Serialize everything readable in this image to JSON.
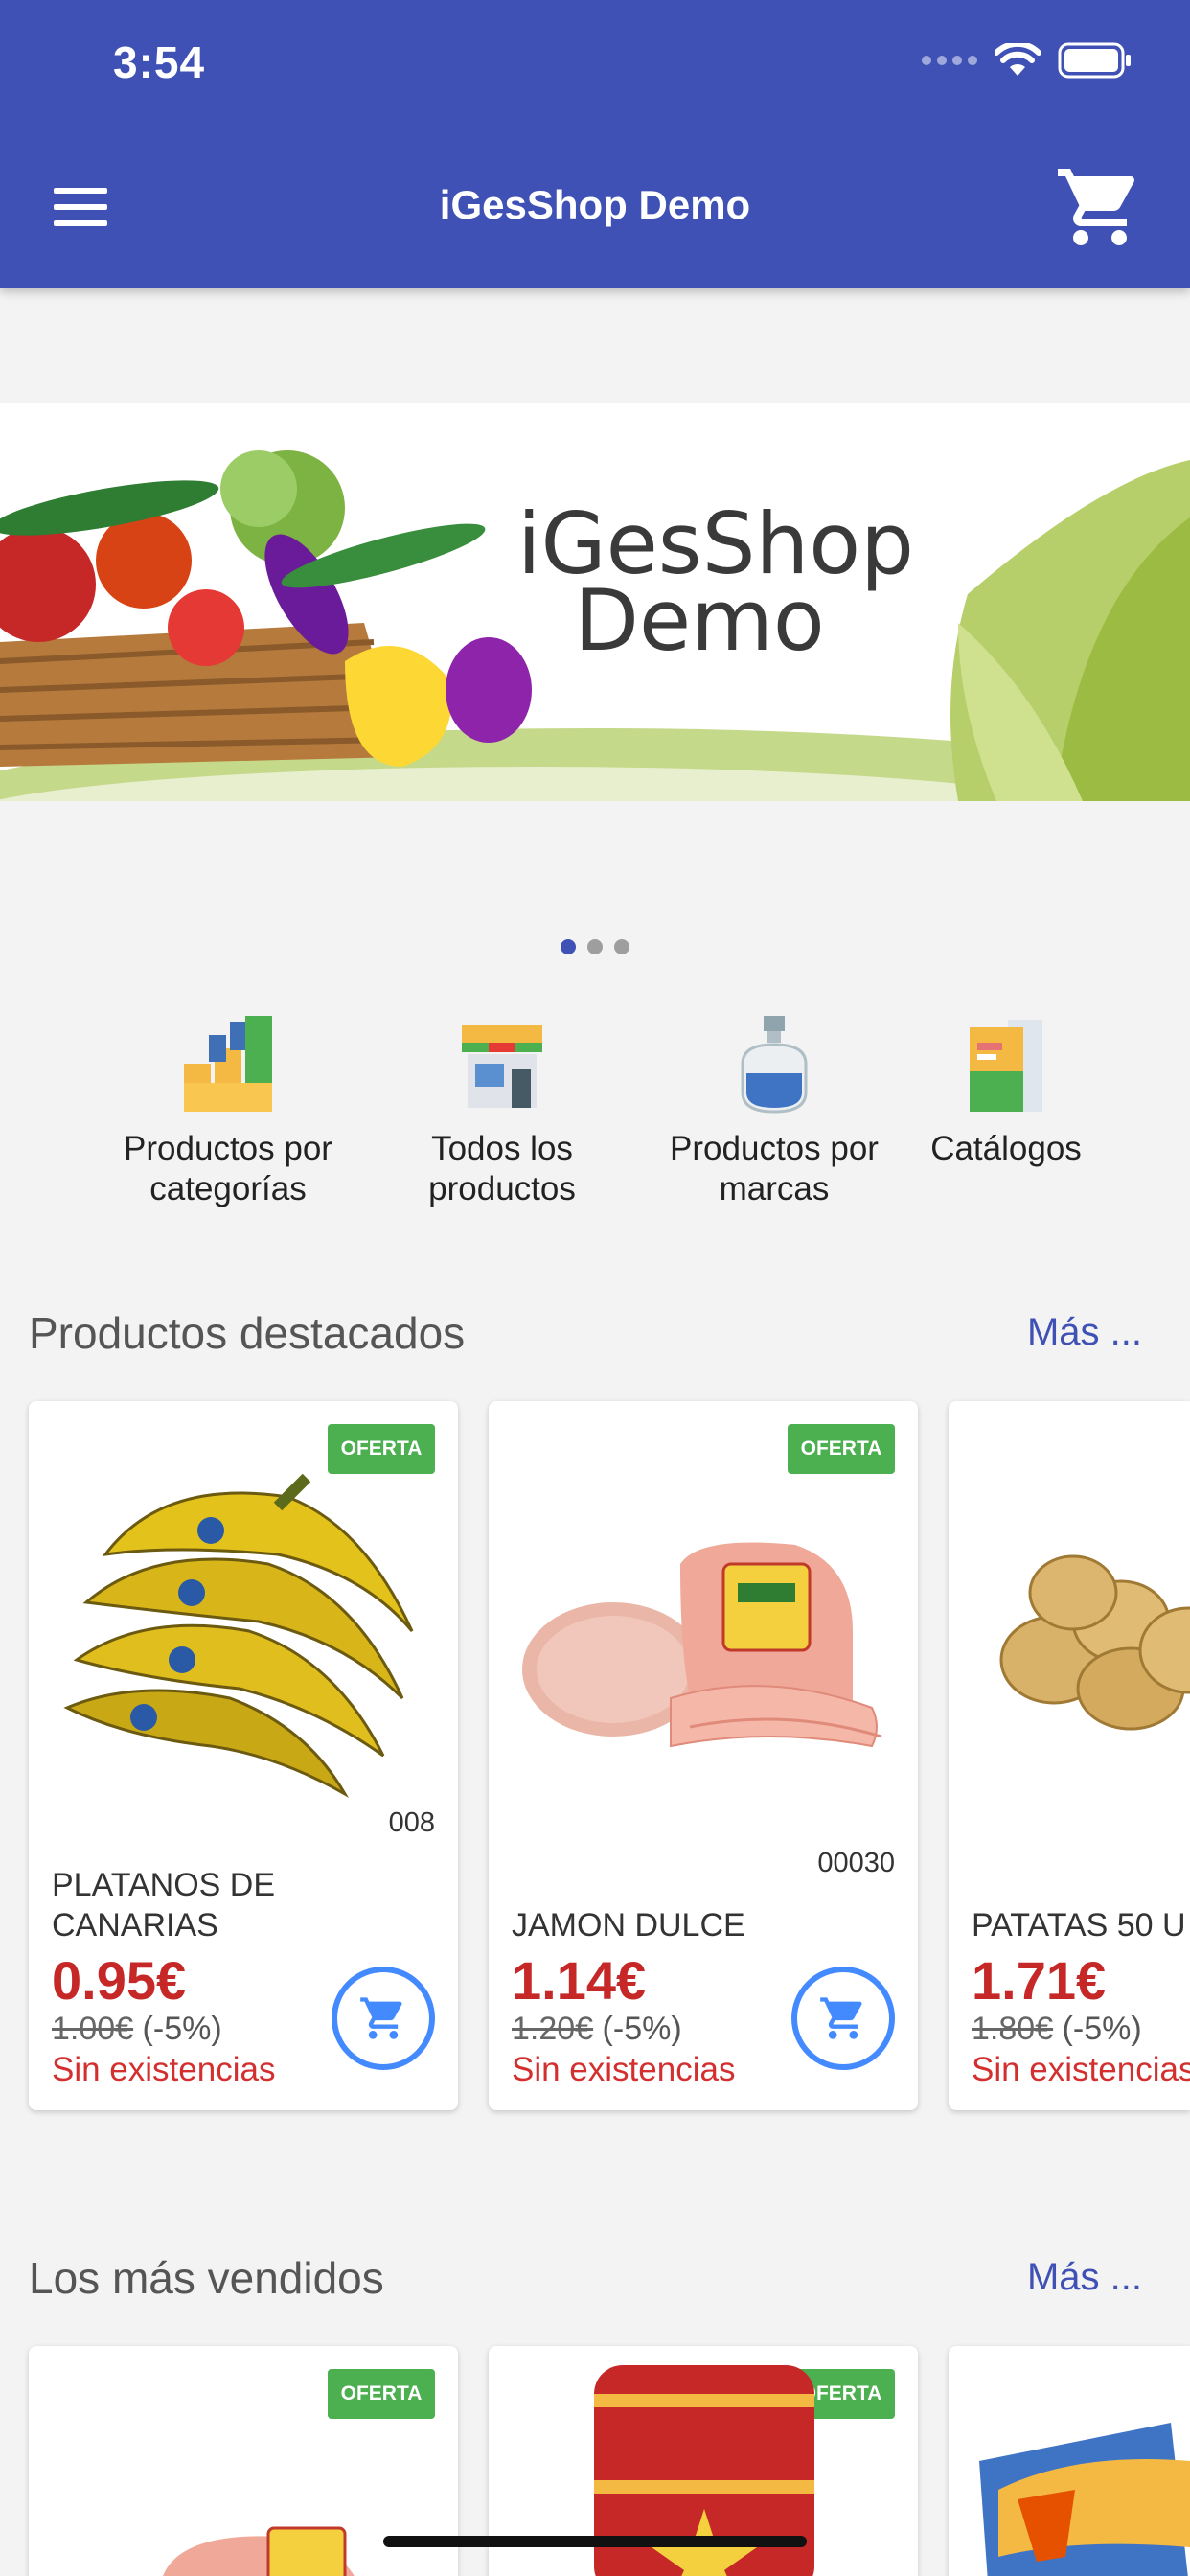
{
  "status_bar": {
    "time": "3:54"
  },
  "header": {
    "title": "iGesShop Demo"
  },
  "banner": {
    "line1": "iGesShop",
    "line2": "Demo"
  },
  "categories": [
    {
      "label_line1": "Productos por",
      "label_line2": "categorías"
    },
    {
      "label_line1": "Todos los",
      "label_line2": "productos"
    },
    {
      "label_line1": "Productos por",
      "label_line2": "marcas"
    },
    {
      "label_line1": "Catálogos",
      "label_line2": ""
    }
  ],
  "featured": {
    "title": "Productos destacados",
    "more": "Más ...",
    "products": [
      {
        "badge": "OFERTA",
        "code": "008",
        "name": "PLATANOS DE CANARIAS",
        "price": "0.95€",
        "old_price": "1.00€",
        "discount": "(-5%)",
        "stock": "Sin existencias"
      },
      {
        "badge": "OFERTA",
        "code": "00030",
        "name": "JAMON DULCE",
        "price": "1.14€",
        "old_price": "1.20€",
        "discount": "(-5%)",
        "stock": "Sin existencias"
      },
      {
        "badge": "",
        "code": "",
        "name": "PATATAS 50 U",
        "price": "1.71€",
        "old_price": "1.80€",
        "discount": "(-5%)",
        "stock": "Sin existencias"
      }
    ]
  },
  "best_sellers": {
    "title": "Los más vendidos",
    "more": "Más ...",
    "products": [
      {
        "badge": "OFERTA"
      },
      {
        "badge": "OFERTA"
      },
      {
        "badge": ""
      }
    ]
  },
  "colors": {
    "primary": "#3f51b5",
    "offer": "#4caf50",
    "price": "#c62828",
    "cart_ring": "#448aff"
  }
}
